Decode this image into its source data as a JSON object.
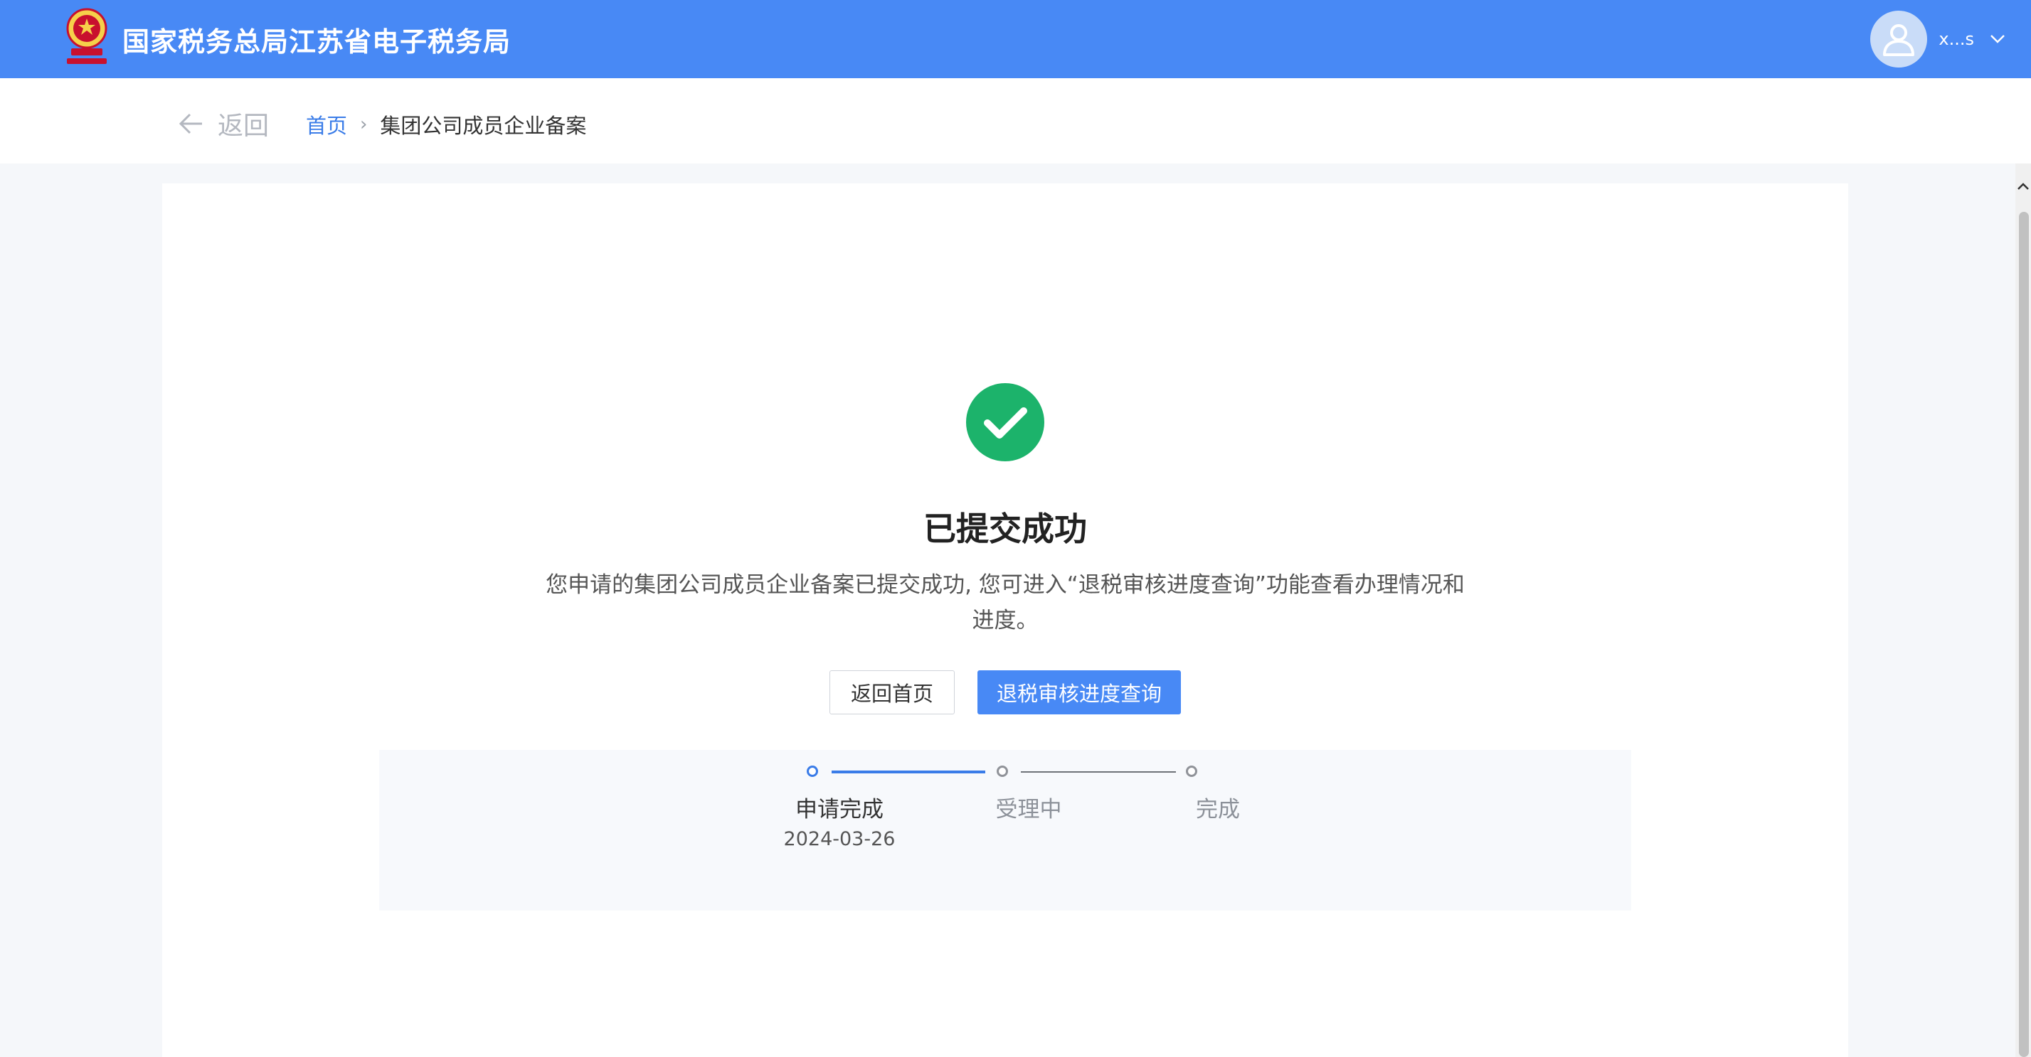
{
  "header": {
    "site_title": "国家税务总局江苏省电子税务局",
    "username": "x...s",
    "brand_color": "#4889f5"
  },
  "breadcrumb": {
    "back_label": "返回",
    "home_label": "首页",
    "separator": "›",
    "current_label": "集团公司成员企业备案"
  },
  "result": {
    "icon": "check-circle-icon",
    "icon_color": "#1cb36b",
    "title": "已提交成功",
    "description": "您申请的集团公司成员企业备案已提交成功, 您可进入“退税审核进度查询”功能查看办理情况和进度。"
  },
  "actions": {
    "home_button": "返回首页",
    "query_button": "退税审核进度查询"
  },
  "steps": [
    {
      "label": "申请完成",
      "date": "2024-03-26",
      "status": "done"
    },
    {
      "label": "受理中",
      "status": "pending"
    },
    {
      "label": "完成",
      "status": "pending"
    }
  ]
}
